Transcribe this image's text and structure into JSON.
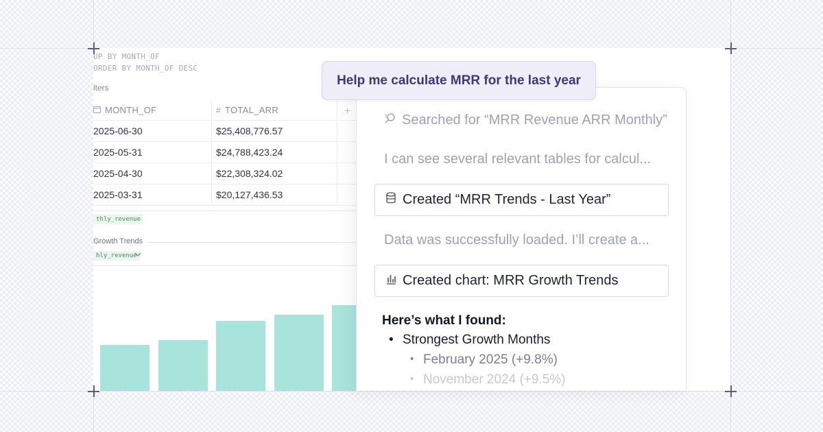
{
  "sql": {
    "line1": "UP BY MONTH_OF",
    "line2": "ORDER BY MONTH_OF DESC"
  },
  "filters_label": "lters",
  "table": {
    "columns": [
      "MONTH_OF",
      "TOTAL_ARR"
    ],
    "add_column": "+",
    "rows": [
      {
        "month": "2025-06-30",
        "arr": "$25,408,776.57"
      },
      {
        "month": "2025-05-31",
        "arr": "$24,788,423.24"
      },
      {
        "month": "2025-04-30",
        "arr": "$22,308,324.02"
      },
      {
        "month": "2025-03-31",
        "arr": "$20,127,436.53"
      }
    ]
  },
  "dataset_tag": "thly_revenue",
  "chart_section": {
    "title": "Growth Trends",
    "dataset_selector": "hly_revenue"
  },
  "chart_data": {
    "type": "bar",
    "bar_color": "#a9e4dc",
    "values": [
      67,
      74,
      102,
      111,
      125
    ]
  },
  "prompt": "Help me calculate MRR for the last year",
  "steps": {
    "searched": "Searched for “MRR Revenue ARR Monthly”",
    "tables_note": "I can see several relevant tables for calcul...",
    "created_dataset": "Created “MRR Trends - Last Year”",
    "loaded_note": "Data was successfully loaded. I’ll create a...",
    "created_chart": "Created chart: MRR Growth Trends"
  },
  "findings": {
    "heading": "Here’s what I found:",
    "bullet": "Strongest Growth Months",
    "sub_items": [
      "February 2025 (+9.8%)",
      "November 2024  (+9.5%)"
    ]
  },
  "colors": {
    "accent": "#3d3a72",
    "prompt_bg": "#efedf8",
    "bar": "#a9e4dc"
  }
}
